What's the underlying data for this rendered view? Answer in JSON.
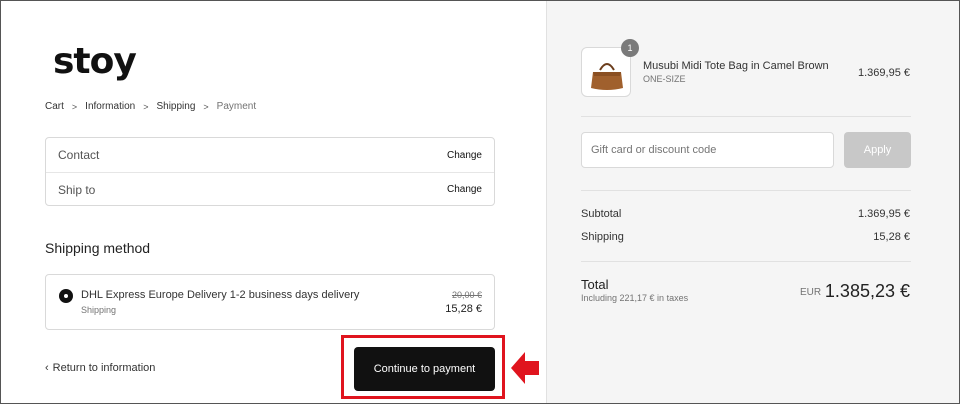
{
  "brand": {
    "logo": "stoy"
  },
  "breadcrumbs": [
    {
      "label": "Cart"
    },
    {
      "label": "Information"
    },
    {
      "label": "Shipping"
    },
    {
      "label": "Payment"
    }
  ],
  "info": {
    "contact_label": "Contact",
    "ship_to_label": "Ship to",
    "change_label": "Change"
  },
  "shipping": {
    "heading": "Shipping method",
    "option_name": "DHL Express Europe Delivery 1-2 business days delivery",
    "option_sub": "Shipping",
    "original_price": "20,00 €",
    "price": "15,28 €"
  },
  "actions": {
    "return_label": "Return to information",
    "continue_label": "Continue to payment"
  },
  "cart": {
    "item_count": "1",
    "product_name": "Musubi Midi Tote Bag in Camel Brown",
    "variant": "ONE-SIZE",
    "product_price": "1.369,95 €"
  },
  "discount": {
    "placeholder": "Gift card or discount code",
    "apply_label": "Apply"
  },
  "summary": {
    "subtotal_label": "Subtotal",
    "subtotal_value": "1.369,95 €",
    "shipping_label": "Shipping",
    "shipping_value": "15,28 €",
    "total_label": "Total",
    "tax_note": "Including 221,17 € in taxes",
    "currency": "EUR",
    "total_value": "1.385,23 €"
  },
  "colors": {
    "accent_dark": "#111111",
    "highlight_red": "#e0141e",
    "apply_disabled": "#c8c8c8"
  }
}
